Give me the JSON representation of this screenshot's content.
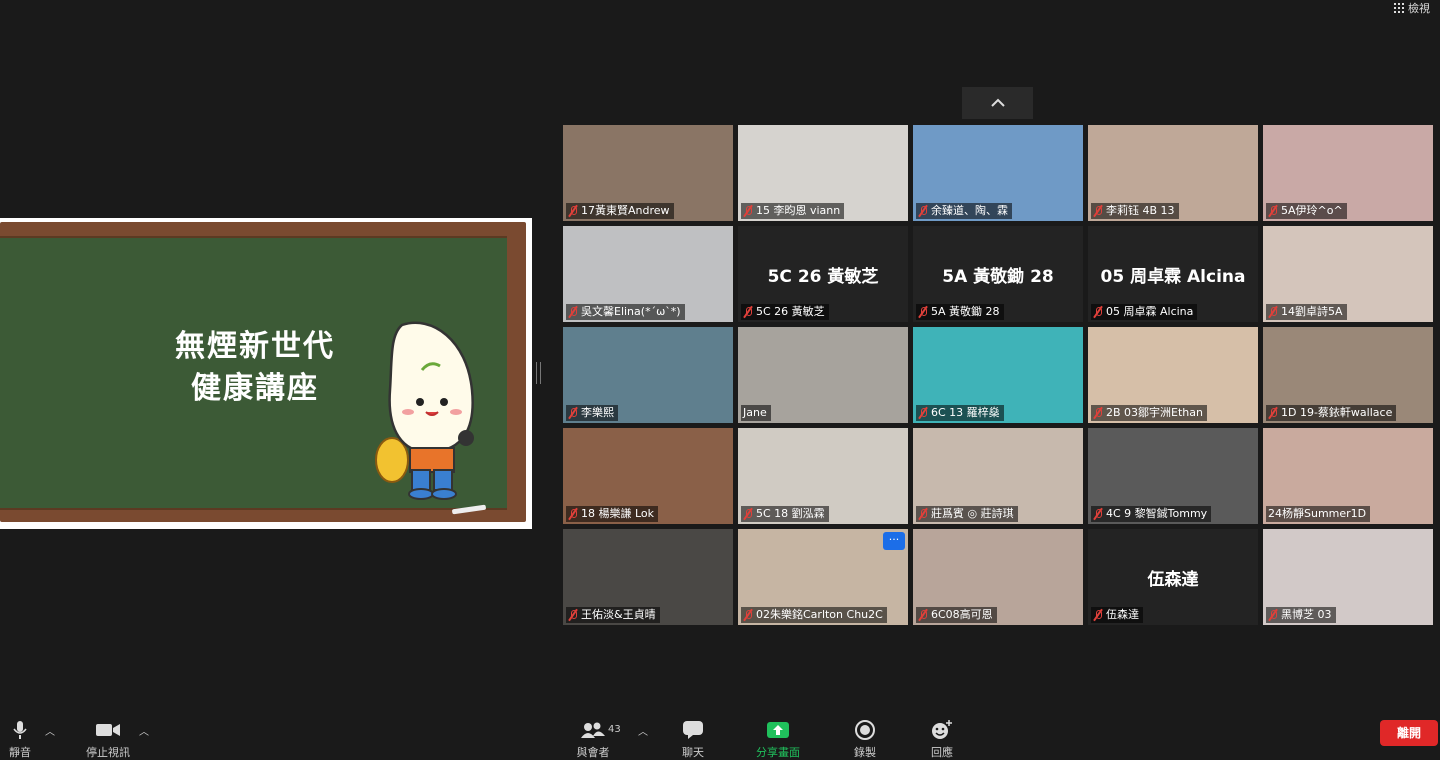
{
  "view_button": {
    "label": "檢視"
  },
  "board": {
    "title_line1": "無煙新世代",
    "title_line2": "健康講座"
  },
  "participants": [
    {
      "name": "17黃東賢Andrew",
      "bg": "#8a7565",
      "muted": true
    },
    {
      "name": "15 李昀恩 viann",
      "bg": "#d6d3cf",
      "muted": true
    },
    {
      "name": "余臻道、陶、霖",
      "bg": "#6f9ac6",
      "muted": true
    },
    {
      "name": "李莉钰 4B 13",
      "bg": "#bfa898",
      "muted": true
    },
    {
      "name": "5A伊玲^o^",
      "bg": "#c9a9a6",
      "muted": true
    },
    {
      "name": "吳文馨Elina(*´ω`*)",
      "bg": "#bfc0c2",
      "muted": true
    },
    {
      "name": "5C 26 黃敏芝",
      "bg": "#232323",
      "muted": true,
      "big": "5C 26 黃敏芝"
    },
    {
      "name": "5A 黃敬鋤 28",
      "bg": "#232323",
      "muted": true,
      "big": "5A 黃敬鋤 28"
    },
    {
      "name": "05 周卓霖 Alcina",
      "bg": "#232323",
      "muted": true,
      "big": "05 周卓霖 Alcina"
    },
    {
      "name": "14劉卓詩5A",
      "bg": "#d4c5bb",
      "muted": true
    },
    {
      "name": "李樂熙",
      "bg": "#5f7f8e",
      "muted": true
    },
    {
      "name": "Jane",
      "bg": "#a7a39d",
      "muted": false,
      "active": true
    },
    {
      "name": "6C 13 羅梓燊",
      "bg": "#3fb3b8",
      "muted": true
    },
    {
      "name": "2B 03鄒宇洲Ethan",
      "bg": "#d6bfa8",
      "muted": true
    },
    {
      "name": "1D 19-蔡銥軒wallace",
      "bg": "#9a8878",
      "muted": true
    },
    {
      "name": "18 楊樂謙 Lok",
      "bg": "#8a6048",
      "muted": true
    },
    {
      "name": "5C 18  劉泓霖",
      "bg": "#d0cbc3",
      "muted": true
    },
    {
      "name": "莊爲賓 ◎ 莊詩琪",
      "bg": "#c7b9ad",
      "muted": true
    },
    {
      "name": "4C 9 黎智鋮Tommy",
      "bg": "#5a5a5a",
      "muted": true
    },
    {
      "name": "24杨靜Summer1D",
      "bg": "#c9aa9e",
      "muted": false
    },
    {
      "name": "王佑淡&王貞晴",
      "bg": "#4a4845",
      "muted": true
    },
    {
      "name": "02朱樂銘Carlton  Chu2C",
      "bg": "#c6b5a3",
      "muted": true,
      "more": true
    },
    {
      "name": "6C08高可恩",
      "bg": "#b8a59a",
      "muted": true
    },
    {
      "name": "伍森達",
      "bg": "#232323",
      "muted": true,
      "big": "伍森達"
    },
    {
      "name": "黑博芝 03",
      "bg": "#d2c9c8",
      "muted": true
    }
  ],
  "toolbar": {
    "mute_label": "靜音",
    "video_label": "停止視訊",
    "participants_label": "與會者",
    "participants_count": "43",
    "chat_label": "聊天",
    "share_label": "分享畫面",
    "record_label": "錄製",
    "reactions_label": "回應",
    "leave_label": "離開",
    "share_color": "#20c05c"
  }
}
